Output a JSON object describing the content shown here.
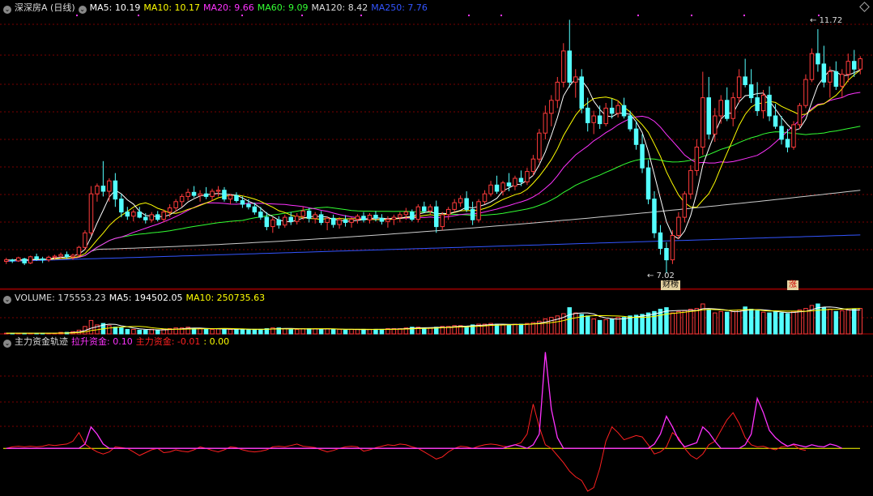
{
  "colors": {
    "up": "#ff3b3b",
    "down": "#54ffff",
    "grid": "#7a0000",
    "ma5": "#ffffff",
    "ma10": "#ffff00",
    "ma20": "#ff33ff",
    "ma60": "#33ff33",
    "ma120": "#cccccc",
    "ma250": "#3355ff",
    "label": "#c8c8c8",
    "yellowRef": "#ffff00",
    "pullFund": "#ff33ff",
    "mainFund": "#ff2020"
  },
  "main_legend": {
    "title": "深深房A (日线)",
    "ma5": "MA5: 10.19",
    "ma10": "MA10: 10.17",
    "ma20": "MA20: 9.66",
    "ma60": "MA60: 9.09",
    "ma120": "MA120: 8.42",
    "ma250": "MA250: 7.76"
  },
  "volume_legend": {
    "label": "VOLUME: 175553.23",
    "ma5": "MA5: 194502.05",
    "ma10": "MA10: 250735.63"
  },
  "fund_legend": {
    "title": "主力资金轨迹",
    "pull": "拉升资金: 0.10",
    "main": "主力资金: -0.01",
    "zero": ": 0.00"
  },
  "annotations": {
    "high": "11.72",
    "low": "7.02",
    "tag_caibang": "财榜",
    "tag_zhang": "涨"
  },
  "icons": {
    "collapse": "chevron-down-icon",
    "settings": "diamond-icon"
  },
  "chart_data": {
    "type": "candlestick",
    "price_range": [
      6.9,
      12.0
    ],
    "volume_range": [
      0,
      750000
    ],
    "fund_range": [
      -0.6,
      1.4
    ],
    "high": 11.72,
    "low": 7.02,
    "ohlc": [
      [
        7.25,
        7.32,
        7.2,
        7.28
      ],
      [
        7.28,
        7.3,
        7.22,
        7.26
      ],
      [
        7.26,
        7.34,
        7.24,
        7.32
      ],
      [
        7.3,
        7.32,
        7.18,
        7.22
      ],
      [
        7.22,
        7.36,
        7.2,
        7.34
      ],
      [
        7.34,
        7.4,
        7.26,
        7.3
      ],
      [
        7.3,
        7.34,
        7.22,
        7.28
      ],
      [
        7.28,
        7.36,
        7.24,
        7.33
      ],
      [
        7.33,
        7.38,
        7.28,
        7.35
      ],
      [
        7.35,
        7.42,
        7.3,
        7.38
      ],
      [
        7.38,
        7.44,
        7.3,
        7.34
      ],
      [
        7.34,
        7.4,
        7.28,
        7.37
      ],
      [
        7.37,
        7.55,
        7.34,
        7.52
      ],
      [
        7.52,
        7.85,
        7.48,
        7.8
      ],
      [
        7.8,
        8.7,
        7.75,
        8.55
      ],
      [
        8.55,
        8.75,
        8.4,
        8.7
      ],
      [
        8.7,
        9.18,
        8.5,
        8.6
      ],
      [
        8.6,
        8.85,
        8.4,
        8.8
      ],
      [
        8.8,
        8.95,
        8.3,
        8.45
      ],
      [
        8.45,
        8.55,
        8.1,
        8.2
      ],
      [
        8.2,
        8.3,
        8.05,
        8.12
      ],
      [
        8.12,
        8.25,
        8.02,
        8.2
      ],
      [
        8.2,
        8.3,
        8.08,
        8.1
      ],
      [
        8.1,
        8.18,
        7.98,
        8.05
      ],
      [
        8.05,
        8.2,
        8.0,
        8.15
      ],
      [
        8.15,
        8.22,
        8.02,
        8.06
      ],
      [
        8.06,
        8.25,
        8.0,
        8.2
      ],
      [
        8.2,
        8.35,
        8.1,
        8.28
      ],
      [
        8.28,
        8.45,
        8.2,
        8.4
      ],
      [
        8.4,
        8.55,
        8.3,
        8.5
      ],
      [
        8.5,
        8.65,
        8.42,
        8.58
      ],
      [
        8.58,
        8.7,
        8.48,
        8.52
      ],
      [
        8.52,
        8.62,
        8.4,
        8.55
      ],
      [
        8.55,
        8.68,
        8.45,
        8.5
      ],
      [
        8.5,
        8.65,
        8.42,
        8.6
      ],
      [
        8.6,
        8.7,
        8.5,
        8.62
      ],
      [
        8.62,
        8.68,
        8.4,
        8.45
      ],
      [
        8.45,
        8.55,
        8.35,
        8.52
      ],
      [
        8.52,
        8.58,
        8.38,
        8.42
      ],
      [
        8.42,
        8.5,
        8.28,
        8.35
      ],
      [
        8.35,
        8.45,
        8.25,
        8.3
      ],
      [
        8.3,
        8.38,
        8.15,
        8.2
      ],
      [
        8.2,
        8.3,
        8.05,
        8.1
      ],
      [
        8.1,
        8.2,
        7.85,
        7.92
      ],
      [
        7.92,
        8.1,
        7.8,
        8.05
      ],
      [
        8.05,
        8.12,
        7.88,
        7.95
      ],
      [
        7.95,
        8.15,
        7.9,
        8.1
      ],
      [
        8.1,
        8.2,
        7.95,
        8.02
      ],
      [
        8.02,
        8.18,
        7.96,
        8.12
      ],
      [
        8.12,
        8.3,
        8.05,
        8.22
      ],
      [
        8.22,
        8.28,
        8.0,
        8.08
      ],
      [
        8.08,
        8.2,
        7.98,
        8.15
      ],
      [
        8.15,
        8.22,
        7.95,
        8.0
      ],
      [
        8.0,
        8.12,
        7.85,
        8.08
      ],
      [
        8.08,
        8.15,
        7.9,
        7.96
      ],
      [
        7.96,
        8.1,
        7.88,
        8.05
      ],
      [
        8.05,
        8.14,
        7.92,
        8.0
      ],
      [
        8.0,
        8.1,
        7.9,
        8.06
      ],
      [
        8.06,
        8.16,
        7.98,
        8.12
      ],
      [
        8.12,
        8.2,
        8.0,
        8.05
      ],
      [
        8.05,
        8.18,
        7.98,
        8.14
      ],
      [
        8.14,
        8.22,
        8.02,
        8.08
      ],
      [
        8.08,
        8.16,
        7.96,
        8.02
      ],
      [
        8.02,
        8.12,
        7.9,
        8.06
      ],
      [
        8.06,
        8.15,
        7.95,
        8.1
      ],
      [
        8.1,
        8.2,
        8.0,
        8.15
      ],
      [
        8.15,
        8.28,
        8.05,
        8.2
      ],
      [
        8.2,
        8.25,
        8.02,
        8.06
      ],
      [
        8.06,
        8.35,
        8.0,
        8.3
      ],
      [
        8.3,
        8.4,
        8.18,
        8.22
      ],
      [
        8.22,
        8.35,
        8.15,
        8.3
      ],
      [
        8.3,
        8.42,
        7.8,
        7.92
      ],
      [
        7.92,
        8.2,
        7.85,
        8.15
      ],
      [
        8.15,
        8.3,
        8.05,
        8.25
      ],
      [
        8.25,
        8.45,
        8.2,
        8.38
      ],
      [
        8.38,
        8.52,
        8.3,
        8.46
      ],
      [
        8.46,
        8.6,
        8.2,
        8.25
      ],
      [
        8.25,
        8.4,
        7.95,
        8.05
      ],
      [
        8.05,
        8.45,
        8.0,
        8.4
      ],
      [
        8.4,
        8.62,
        8.35,
        8.55
      ],
      [
        8.55,
        8.8,
        8.5,
        8.72
      ],
      [
        8.72,
        8.9,
        8.55,
        8.6
      ],
      [
        8.6,
        8.8,
        8.52,
        8.76
      ],
      [
        8.76,
        8.95,
        8.6,
        8.7
      ],
      [
        8.7,
        8.9,
        8.62,
        8.85
      ],
      [
        8.85,
        9.0,
        8.7,
        8.78
      ],
      [
        8.78,
        9.05,
        8.72,
        8.98
      ],
      [
        8.98,
        9.3,
        8.9,
        9.22
      ],
      [
        9.22,
        9.8,
        9.15,
        9.72
      ],
      [
        9.72,
        10.25,
        9.6,
        10.1
      ],
      [
        10.1,
        10.45,
        9.85,
        10.35
      ],
      [
        10.35,
        10.8,
        10.2,
        10.7
      ],
      [
        10.7,
        11.45,
        10.6,
        11.3
      ],
      [
        11.3,
        11.9,
        10.6,
        10.7
      ],
      [
        10.7,
        10.95,
        10.4,
        10.8
      ],
      [
        10.8,
        10.95,
        10.1,
        10.2
      ],
      [
        10.2,
        10.4,
        9.75,
        9.92
      ],
      [
        9.92,
        10.15,
        9.7,
        10.05
      ],
      [
        10.05,
        10.25,
        9.8,
        9.9
      ],
      [
        9.9,
        10.3,
        9.85,
        10.2
      ],
      [
        10.2,
        10.38,
        10.0,
        10.1
      ],
      [
        10.1,
        10.35,
        10.02,
        10.25
      ],
      [
        10.25,
        10.4,
        10.0,
        10.05
      ],
      [
        10.05,
        10.15,
        9.75,
        9.8
      ],
      [
        9.8,
        9.95,
        9.4,
        9.5
      ],
      [
        9.5,
        9.7,
        8.95,
        9.05
      ],
      [
        9.05,
        9.2,
        8.35,
        8.45
      ],
      [
        8.45,
        8.6,
        7.7,
        7.8
      ],
      [
        7.8,
        7.95,
        7.38,
        7.5
      ],
      [
        7.5,
        7.62,
        7.02,
        7.28
      ],
      [
        7.28,
        7.85,
        7.2,
        7.75
      ],
      [
        7.75,
        8.2,
        7.68,
        8.1
      ],
      [
        8.1,
        8.6,
        8.0,
        8.55
      ],
      [
        8.55,
        9.1,
        8.45,
        9.0
      ],
      [
        9.0,
        9.6,
        8.9,
        9.45
      ],
      [
        9.45,
        10.9,
        9.3,
        10.4
      ],
      [
        10.4,
        10.8,
        9.6,
        9.7
      ],
      [
        9.7,
        10.2,
        9.55,
        10.05
      ],
      [
        10.05,
        10.45,
        9.9,
        10.35
      ],
      [
        10.35,
        10.6,
        9.95,
        10.0
      ],
      [
        10.0,
        10.5,
        9.85,
        10.4
      ],
      [
        10.4,
        10.95,
        10.3,
        10.8
      ],
      [
        10.8,
        11.15,
        10.6,
        10.65
      ],
      [
        10.65,
        10.95,
        10.3,
        10.4
      ],
      [
        10.4,
        10.7,
        10.05,
        10.15
      ],
      [
        10.15,
        10.55,
        10.0,
        10.45
      ],
      [
        10.45,
        10.62,
        9.95,
        10.05
      ],
      [
        10.05,
        10.28,
        9.8,
        9.85
      ],
      [
        9.85,
        10.05,
        9.5,
        9.6
      ],
      [
        9.6,
        9.8,
        9.35,
        9.45
      ],
      [
        9.45,
        9.95,
        9.4,
        9.88
      ],
      [
        9.88,
        10.3,
        9.8,
        10.25
      ],
      [
        10.25,
        10.85,
        10.2,
        10.75
      ],
      [
        10.75,
        11.35,
        10.7,
        11.25
      ],
      [
        11.25,
        11.72,
        10.9,
        11.05
      ],
      [
        11.05,
        11.4,
        10.6,
        10.7
      ],
      [
        10.7,
        11.0,
        10.4,
        10.9
      ],
      [
        10.9,
        11.1,
        10.55,
        10.62
      ],
      [
        10.62,
        10.95,
        10.4,
        10.85
      ],
      [
        10.85,
        11.25,
        10.7,
        11.1
      ],
      [
        11.1,
        11.32,
        10.8,
        10.95
      ],
      [
        10.95,
        11.2,
        10.85,
        11.15
      ]
    ],
    "volume": [
      1,
      1,
      1,
      1,
      1,
      1,
      1,
      1,
      1,
      2,
      2,
      3,
      5,
      10,
      18,
      12,
      14,
      11,
      9,
      8,
      6,
      6,
      5,
      5,
      6,
      5,
      6,
      7,
      8,
      8,
      9,
      7,
      7,
      6,
      6,
      7,
      7,
      6,
      6,
      6,
      6,
      6,
      6,
      7,
      8,
      8,
      7,
      6,
      6,
      7,
      7,
      7,
      6,
      7,
      6,
      6,
      5,
      6,
      6,
      6,
      6,
      6,
      6,
      7,
      7,
      7,
      8,
      9,
      9,
      8,
      8,
      9,
      10,
      10,
      11,
      11,
      10,
      12,
      13,
      13,
      14,
      13,
      12,
      12,
      13,
      13,
      14,
      15,
      17,
      20,
      22,
      24,
      27,
      35,
      28,
      26,
      24,
      20,
      18,
      19,
      20,
      22,
      22,
      24,
      25,
      26,
      28,
      30,
      33,
      35,
      28,
      30,
      31,
      33,
      34,
      40,
      32,
      28,
      30,
      29,
      30,
      32,
      36,
      33,
      31,
      29,
      28,
      30,
      28,
      27,
      30,
      32,
      34,
      38,
      40,
      35,
      33,
      30,
      31,
      32,
      33,
      34
    ],
    "pull_fund": [
      0,
      0,
      0,
      0,
      0,
      0,
      0,
      0,
      0,
      0,
      0,
      0,
      0,
      0.06,
      0.3,
      0.2,
      0.06,
      0,
      0,
      0,
      0,
      0,
      0,
      0,
      0,
      0,
      0,
      0,
      0,
      0,
      0,
      0,
      0,
      0,
      0,
      0,
      0,
      0,
      0,
      0,
      0,
      0,
      0,
      0,
      0,
      0,
      0,
      0,
      0,
      0,
      0,
      0,
      0,
      0,
      0,
      0,
      0,
      0,
      0,
      0,
      0,
      0,
      0,
      0,
      0,
      0,
      0,
      0,
      0,
      0,
      0,
      0,
      0,
      0,
      0,
      0,
      0,
      0,
      0,
      0,
      0,
      0,
      0,
      0.03,
      0.05,
      0.03,
      0,
      0.05,
      0.2,
      1.35,
      0.55,
      0.15,
      0,
      0,
      0,
      0,
      0,
      0,
      0,
      0,
      0,
      0,
      0,
      0,
      0,
      0,
      0,
      0.06,
      0.2,
      0.45,
      0.3,
      0.12,
      0.02,
      0.05,
      0.08,
      0.3,
      0.22,
      0.1,
      0,
      0,
      0,
      0,
      0.05,
      0.2,
      0.7,
      0.5,
      0.25,
      0.15,
      0.08,
      0.03,
      0.06,
      0.04,
      0.02,
      0.05,
      0.03,
      0.02,
      0.06,
      0.04,
      0
    ],
    "main_fund": [
      0,
      0.02,
      0.03,
      0.02,
      0.03,
      0.02,
      0.03,
      0.05,
      0.04,
      0.05,
      0.06,
      0.1,
      0.22,
      0.06,
      0,
      -0.05,
      -0.08,
      -0.05,
      0.02,
      0.01,
      0,
      -0.05,
      -0.1,
      -0.06,
      -0.02,
      0,
      -0.06,
      -0.05,
      -0.02,
      -0.04,
      -0.05,
      -0.02,
      0.02,
      0,
      -0.03,
      -0.05,
      -0.02,
      0.02,
      0.01,
      -0.02,
      -0.04,
      -0.05,
      -0.04,
      -0.02,
      0.02,
      0.03,
      0.02,
      0.04,
      0.06,
      0.03,
      0.02,
      0.01,
      -0.02,
      -0.05,
      -0.03,
      0,
      0.02,
      0.03,
      0.02,
      -0.04,
      -0.02,
      0.01,
      0.03,
      0.05,
      0.04,
      0.06,
      0.05,
      0.02,
      0,
      -0.05,
      -0.1,
      -0.15,
      -0.12,
      -0.05,
      0,
      0.03,
      0.02,
      0,
      0.03,
      0.05,
      0.06,
      0.05,
      0.03,
      0.02,
      0.05,
      0.08,
      0.2,
      0.62,
      0.3,
      0.05,
      0,
      -0.1,
      -0.2,
      -0.32,
      -0.4,
      -0.45,
      -0.6,
      -0.55,
      -0.28,
      0.1,
      0.3,
      0.22,
      0.12,
      0.15,
      0.18,
      0.16,
      0.05,
      -0.08,
      -0.05,
      0.02,
      0.22,
      0.15,
      0,
      -0.1,
      -0.15,
      -0.08,
      0.05,
      0.1,
      0.25,
      0.4,
      0.5,
      0.35,
      0.15,
      0.05,
      0.02,
      0.03,
      0,
      -0.02,
      0.02,
      0.03,
      0.05,
      -0.01,
      -0.03
    ]
  }
}
